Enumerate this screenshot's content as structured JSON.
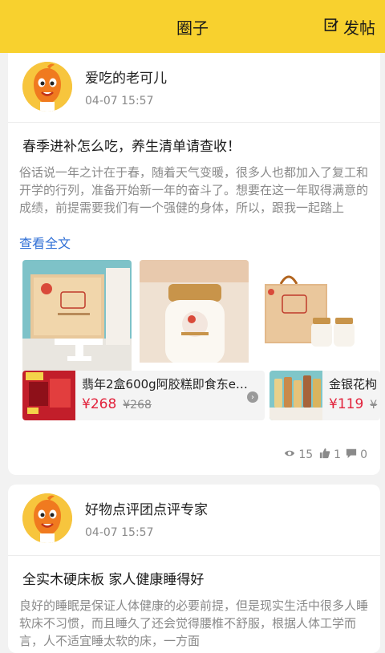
{
  "header": {
    "title": "圈子",
    "post_label": "发帖"
  },
  "posts": [
    {
      "author": "爱吃的老可儿",
      "time": "04-07 15:57",
      "title": "春季进补怎么吃，养生清单请查收！",
      "body": "俗话说一年之计在于春，随着天气变暖，很多人也都加入了复工和开学的行列，准备开始新一年的奋斗了。想要在这一年取得满意的成绩，前提需要我们有一个强健的身体，所以，跟我一起踏上",
      "read_more": "查看全文",
      "products": [
        {
          "name": "翡年2盒600g阿胶糕即食东e…",
          "price": "¥268",
          "orig_price": "¥268"
        },
        {
          "name": "金银花枸",
          "price": "¥119",
          "orig_price": "¥"
        }
      ],
      "stats": {
        "views": "15",
        "likes": "1",
        "comments": "0"
      }
    },
    {
      "author": "好物点评团点评专家",
      "time": "04-07 15:57",
      "title": "全实木硬床板 家人健康睡得好",
      "body": "良好的睡眠是保证人体健康的必要前提，但是现实生活中很多人睡软床不习惯，而且睡久了还会觉得腰椎不舒服，根据人体工学而言，人不适宜睡太软的床，一方面"
    }
  ],
  "colors": {
    "brand": "#f8d12e",
    "price": "#e2233c",
    "link": "#2f6fd6"
  }
}
